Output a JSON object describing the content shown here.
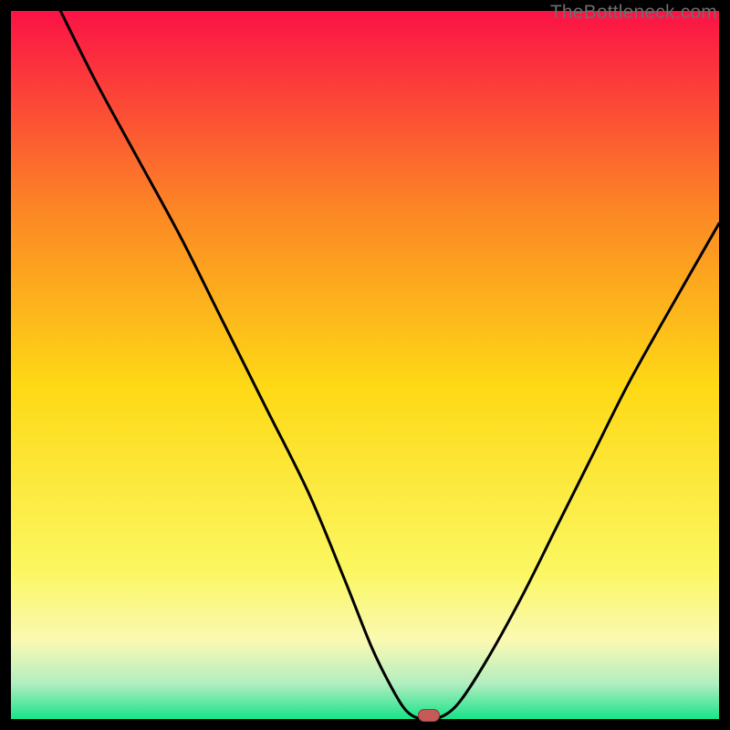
{
  "watermark": "TheBottleneck.com",
  "colors": {
    "gradient_top": "#fb1246",
    "gradient_q1": "#fc8625",
    "gradient_mid": "#fed915",
    "gradient_q3a": "#fbf761",
    "gradient_q3b": "#faf9b3",
    "gradient_near_bottom": "#b2eec0",
    "gradient_bottom": "#18e389",
    "curve": "#000000",
    "marker": "#c65a57",
    "marker_stroke": "#8f3d3b",
    "frame": "#000000"
  },
  "chart_data": {
    "type": "line",
    "title": "",
    "xlabel": "",
    "ylabel": "",
    "xlim": [
      0,
      100
    ],
    "ylim": [
      0,
      100
    ],
    "grid": false,
    "series": [
      {
        "name": "bottleneck-curve",
        "x": [
          7,
          12,
          18,
          24,
          30,
          36,
          42,
          47,
          51,
          54,
          56,
          58,
          60,
          63,
          67,
          72,
          77,
          82,
          87,
          92,
          100
        ],
        "y": [
          100,
          90,
          79,
          68,
          56,
          44,
          32,
          20,
          10,
          4,
          1,
          0,
          0,
          2,
          8,
          17,
          27,
          37,
          47,
          56,
          70
        ]
      }
    ],
    "annotations": [
      {
        "name": "optimal-marker",
        "x": 59,
        "y": 0.5
      }
    ]
  }
}
